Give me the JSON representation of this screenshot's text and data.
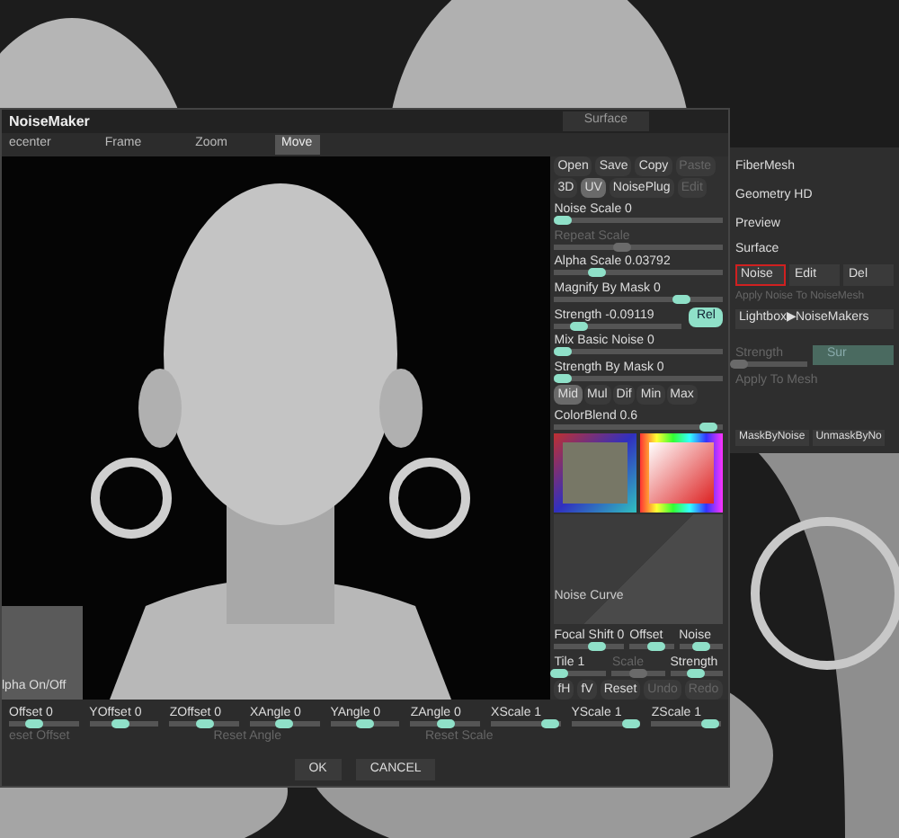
{
  "dialog": {
    "title": "NoiseMaker",
    "tab": "Surface",
    "toolbar": [
      {
        "label": "ecenter",
        "selected": false
      },
      {
        "label": "Frame",
        "selected": false
      },
      {
        "label": "Zoom",
        "selected": false
      },
      {
        "label": "Move",
        "selected": true
      }
    ],
    "alpha_thumb": "lpha On/Off",
    "file_buttons": [
      {
        "label": "Open",
        "disabled": false
      },
      {
        "label": "Save",
        "disabled": false
      },
      {
        "label": "Copy",
        "disabled": false
      },
      {
        "label": "Paste",
        "disabled": true
      }
    ],
    "mode_buttons": [
      {
        "label": "3D",
        "selected": false,
        "disabled": false
      },
      {
        "label": "UV",
        "selected": true,
        "disabled": false
      },
      {
        "label": "NoisePlug",
        "selected": false,
        "disabled": false
      },
      {
        "label": "Edit",
        "selected": false,
        "disabled": true
      }
    ],
    "sliders": [
      {
        "label": "Noise Scale 0",
        "level": 0.05,
        "disabled": false
      },
      {
        "label": "Repeat Scale",
        "level": 0.4,
        "disabled": true
      },
      {
        "label": "Alpha Scale 0.03792",
        "level": 0.25,
        "disabled": false
      },
      {
        "label": "Magnify By Mask 0",
        "level": 0.75,
        "disabled": false
      },
      {
        "label": "Strength -0.09119",
        "level": 0.2,
        "disabled": false,
        "button": "Rel"
      },
      {
        "label": "Mix Basic Noise 0",
        "level": 0.05,
        "disabled": false
      },
      {
        "label": "Strength By Mask 0",
        "level": 0.05,
        "disabled": false
      }
    ],
    "blend_modes": [
      {
        "label": "Mid",
        "selected": true
      },
      {
        "label": "Mul",
        "selected": false
      },
      {
        "label": "Dif",
        "selected": false
      },
      {
        "label": "Min",
        "selected": false
      },
      {
        "label": "Max",
        "selected": false
      }
    ],
    "color_blend": {
      "label": "ColorBlend 0.6",
      "level": 0.92
    },
    "noise_curve": "Noise Curve",
    "curve_rows": [
      [
        {
          "label": "Focal Shift 0",
          "level": 0.6,
          "disabled": false
        },
        {
          "label": "Offset",
          "level": 0.6,
          "disabled": false
        },
        {
          "label": "Noise",
          "level": 0.5,
          "disabled": false
        }
      ],
      [
        {
          "label": "Tile 1",
          "level": 0.1,
          "disabled": false
        },
        {
          "label": "Scale",
          "level": 0.5,
          "disabled": true
        },
        {
          "label": "Strength",
          "level": 0.5,
          "disabled": false
        }
      ]
    ],
    "curve_buttons": [
      {
        "label": "fH",
        "disabled": false
      },
      {
        "label": "fV",
        "disabled": false
      },
      {
        "label": "Reset",
        "disabled": false
      },
      {
        "label": "Undo",
        "disabled": true
      },
      {
        "label": "Redo",
        "disabled": true
      }
    ],
    "transform_sliders": [
      {
        "label": "Offset 0",
        "level": 0.35
      },
      {
        "label": "YOffset 0",
        "level": 0.45
      },
      {
        "label": "ZOffset 0",
        "level": 0.5
      },
      {
        "label": "XAngle 0",
        "level": 0.5
      },
      {
        "label": "YAngle 0",
        "level": 0.5
      },
      {
        "label": "ZAngle 0",
        "level": 0.5
      },
      {
        "label": "XScale 1",
        "level": 0.85
      },
      {
        "label": "YScale 1",
        "level": 0.85
      },
      {
        "label": "ZScale 1",
        "level": 0.85
      }
    ],
    "reset_buttons": [
      "eset Offset",
      "Reset Angle",
      "Reset Scale"
    ],
    "actions": [
      "OK",
      "CANCEL"
    ]
  },
  "panel": {
    "menu": [
      "FiberMesh",
      "Geometry HD",
      "Preview"
    ],
    "section": "Surface",
    "noise_buttons": [
      {
        "label": "Noise",
        "outlined": true
      },
      {
        "label": "Edit",
        "outlined": false
      },
      {
        "label": "Del",
        "outlined": false
      }
    ],
    "apply_noise": {
      "label": "Apply Noise To NoiseMesh",
      "disabled": true
    },
    "lightbox": "Lightbox▶NoiseMakers",
    "strength": {
      "label": "Strength",
      "level": 0.05,
      "disabled": true
    },
    "sur": "Sur",
    "apply_mesh": {
      "label": "Apply To Mesh",
      "disabled": true
    },
    "mask_buttons": [
      "MaskByNoise",
      "UnmaskByNo"
    ]
  }
}
